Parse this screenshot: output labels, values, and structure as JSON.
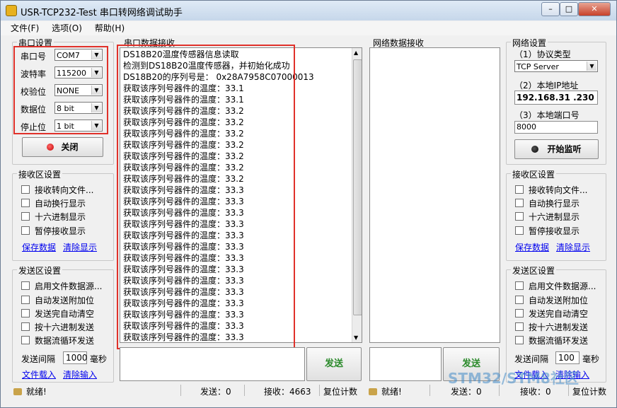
{
  "title": "USR-TCP232-Test 串口转网络调试助手",
  "win_buttons": {
    "min": "–",
    "max": "□",
    "close": "✕"
  },
  "menu": [
    "文件(F)",
    "选项(O)",
    "帮助(H)"
  ],
  "serial_settings": {
    "group": "串口设置",
    "fields": [
      {
        "label": "串口号",
        "value": "COM7"
      },
      {
        "label": "波特率",
        "value": "115200"
      },
      {
        "label": "校验位",
        "value": "NONE"
      },
      {
        "label": "数据位",
        "value": "8 bit"
      },
      {
        "label": "停止位",
        "value": "1 bit"
      }
    ],
    "close_button": "关闭"
  },
  "serial_recv_settings": {
    "group": "接收区设置",
    "options": [
      "接收转向文件...",
      "自动换行显示",
      "十六进制显示",
      "暂停接收显示"
    ],
    "save": "保存数据",
    "clear": "清除显示"
  },
  "serial_send_settings": {
    "group": "发送区设置",
    "options": [
      "启用文件数据源...",
      "自动发送附加位",
      "发送完自动清空",
      "按十六进制发送",
      "数据流循环发送"
    ],
    "interval_label": "发送间隔",
    "interval_value": "1000",
    "interval_unit": "毫秒",
    "load": "文件载入",
    "clear": "清除输入"
  },
  "serial_receive": {
    "group": "串口数据接收",
    "lines": [
      "DS18B20温度传感器信息读取",
      "检测到DS18B20温度传感器，并初始化成功",
      "DS18B20的序列号是： 0x28A7958C07000013",
      "获取该序列号器件的温度：33.1",
      "获取该序列号器件的温度：33.1",
      "获取该序列号器件的温度：33.2",
      "获取该序列号器件的温度：33.2",
      "获取该序列号器件的温度：33.2",
      "获取该序列号器件的温度：33.2",
      "获取该序列号器件的温度：33.2",
      "获取该序列号器件的温度：33.2",
      "获取该序列号器件的温度：33.2",
      "获取该序列号器件的温度：33.3",
      "获取该序列号器件的温度：33.3",
      "获取该序列号器件的温度：33.3",
      "获取该序列号器件的温度：33.3",
      "获取该序列号器件的温度：33.3",
      "获取该序列号器件的温度：33.3",
      "获取该序列号器件的温度：33.3",
      "获取该序列号器件的温度：33.3",
      "获取该序列号器件的温度：33.3",
      "获取该序列号器件的温度：33.3",
      "获取该序列号器件的温度：33.3",
      "获取该序列号器件的温度：33.3",
      "获取该序列号器件的温度：33.3",
      "获取该序列号器件的温度：33.3"
    ]
  },
  "net_receive": {
    "group": "网络数据接收"
  },
  "net_settings": {
    "group": "网络设置",
    "protocol_label": "（1）协议类型",
    "protocol_value": "TCP Server",
    "ip_label": "（2）本地IP地址",
    "ip_value": "192.168.31 .230",
    "port_label": "（3）本地端口号",
    "port_value": "8000",
    "listen_button": "开始监听"
  },
  "net_recv_settings": {
    "group": "接收区设置",
    "options": [
      "接收转向文件...",
      "自动换行显示",
      "十六进制显示",
      "暂停接收显示"
    ],
    "save": "保存数据",
    "clear": "清除显示"
  },
  "net_send_settings": {
    "group": "发送区设置",
    "options": [
      "启用文件数据源...",
      "自动发送附加位",
      "发送完自动清空",
      "按十六进制发送",
      "数据流循环发送"
    ],
    "interval_label": "发送间隔",
    "interval_value": "100",
    "interval_unit": "毫秒",
    "load": "文件载入",
    "clear": "清除输入"
  },
  "send_button": "发送",
  "net_send_button": "发送",
  "status_left": {
    "ready": "就绪!",
    "sent": "发送：0",
    "recv": "接收：4663",
    "reset": "复位计数"
  },
  "status_right": {
    "ready": "就绪!",
    "sent": "发送：0",
    "recv": "接收：0",
    "reset": "复位计数"
  },
  "watermark": "STM32/STM8社区",
  "colors": {
    "highlight": "#e0312a",
    "link": "#0000ee",
    "send_text": "#2a8a2a"
  }
}
